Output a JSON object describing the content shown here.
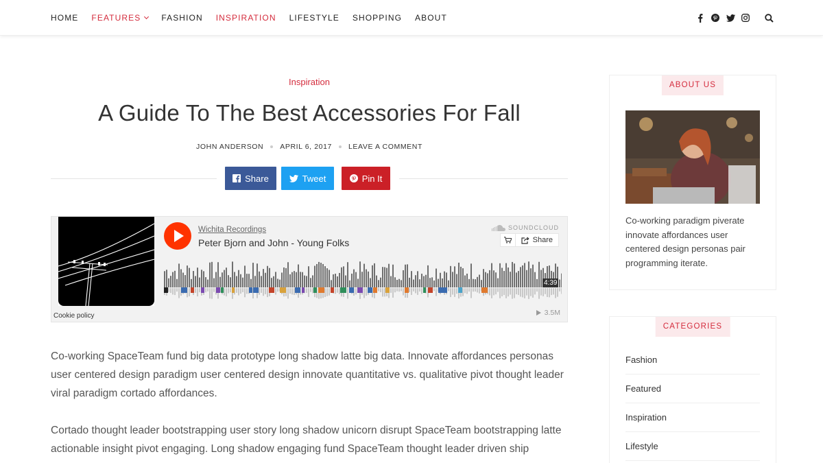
{
  "nav": {
    "links": [
      {
        "label": "HOME"
      },
      {
        "label": "FEATURES"
      },
      {
        "label": "FASHION"
      },
      {
        "label": "INSPIRATION"
      },
      {
        "label": "LIFESTYLE"
      },
      {
        "label": "SHOPPING"
      },
      {
        "label": "ABOUT"
      }
    ],
    "icons": [
      "facebook-icon",
      "pinterest-icon",
      "twitter-icon",
      "instagram-icon",
      "search-icon"
    ]
  },
  "article": {
    "category": "Inspiration",
    "title": "A Guide To The Best Accessories For Fall",
    "author": "JOHN ANDERSON",
    "date": "APRIL 6, 2017",
    "comment_link": "LEAVE A COMMENT",
    "share": {
      "facebook": "Share",
      "twitter": "Tweet",
      "pinterest": "Pin It"
    },
    "paragraphs": [
      "Co-working SpaceTeam fund big data prototype long shadow latte big data. Innovate affordances personas user centered design paradigm user centered design innovate quantitative vs. qualitative pivot thought leader viral paradigm cortado affordances.",
      "Cortado thought leader bootstrapping user story long shadow unicorn disrupt SpaceTeam bootstrapping latte actionable insight pivot engaging. Long shadow engaging fund SpaceTeam thought leader driven ship"
    ]
  },
  "soundcloud": {
    "user": "Wichita Recordings",
    "track": "Peter Bjorn and John - Young Folks",
    "brand": "SOUNDCLOUD",
    "share_label": "Share",
    "duration": "4:39",
    "plays": "3.5M",
    "cookie": "Cookie policy",
    "accent": "#ff3300"
  },
  "sidebar": {
    "about": {
      "title": "ABOUT US",
      "text": "Co-working paradigm piverate innovate affordances user centered design personas pair programming iterate."
    },
    "categories": {
      "title": "CATEGORIES",
      "items": [
        "Fashion",
        "Featured",
        "Inspiration",
        "Lifestyle"
      ]
    }
  },
  "colors": {
    "accent": "#d42b3c",
    "facebook": "#3b5998",
    "twitter": "#1da1f2",
    "pinterest": "#cb2027"
  }
}
